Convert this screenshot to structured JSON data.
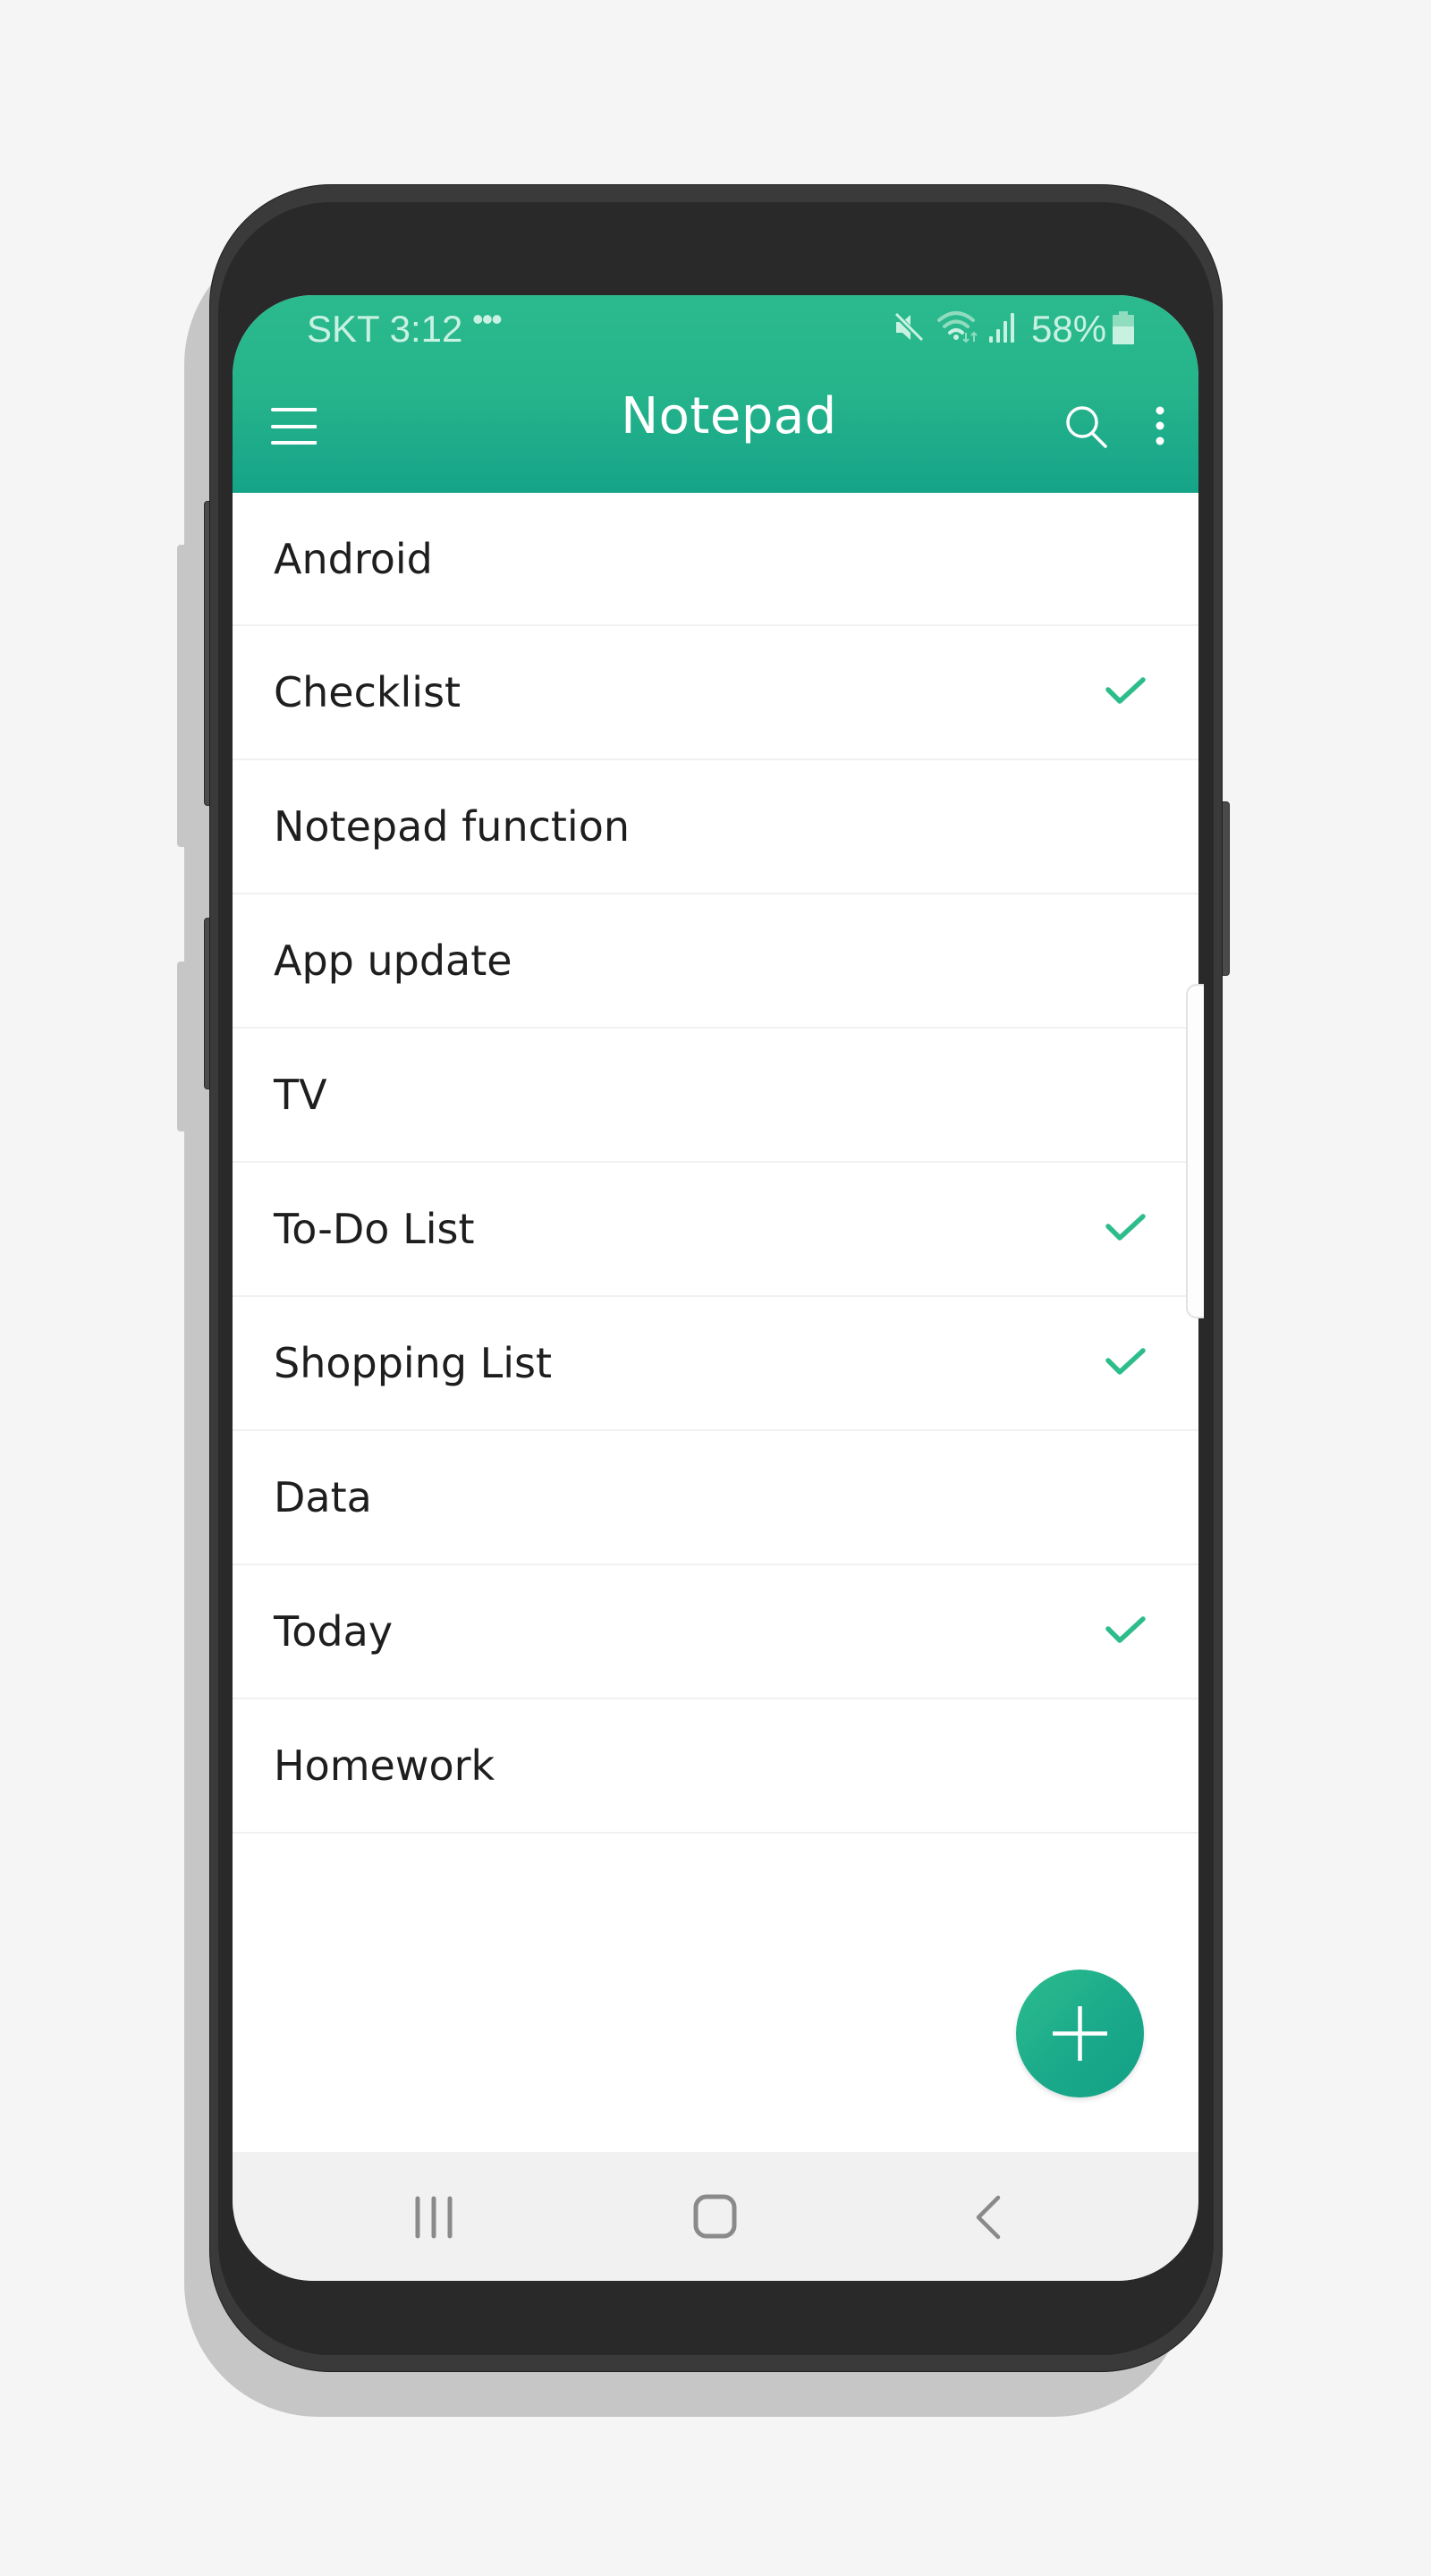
{
  "status_bar": {
    "carrier_time": "SKT 3:12",
    "more_indicator": "•••",
    "battery_percent": "58%",
    "icons": [
      "mute-icon",
      "wifi-icon",
      "signal-icon",
      "battery-icon"
    ]
  },
  "app_bar": {
    "title": "Notepad",
    "menu_icon": "hamburger-menu-icon",
    "search_icon": "search-icon",
    "overflow_icon": "more-vertical-icon"
  },
  "notes": [
    {
      "title": "Android",
      "checklist": false
    },
    {
      "title": "Checklist",
      "checklist": true
    },
    {
      "title": "Notepad function",
      "checklist": false
    },
    {
      "title": "App update",
      "checklist": false
    },
    {
      "title": "TV",
      "checklist": false
    },
    {
      "title": "To-Do List",
      "checklist": true
    },
    {
      "title": "Shopping List",
      "checklist": true
    },
    {
      "title": "Data",
      "checklist": false
    },
    {
      "title": "Today",
      "checklist": true
    },
    {
      "title": "Homework",
      "checklist": false
    }
  ],
  "fab": {
    "icon": "plus-icon"
  },
  "nav_bar": {
    "recents_icon": "recents-icon",
    "home_icon": "home-icon",
    "back_icon": "back-icon"
  },
  "colors": {
    "accent": "#1fb08a",
    "accent_light": "#2bba8d",
    "check": "#2dbd8a",
    "status_text": "#c8f1e1",
    "nav_icon": "#8a8a8a",
    "nav_background": "#f1f1f1",
    "background": "#f5f5f5"
  }
}
